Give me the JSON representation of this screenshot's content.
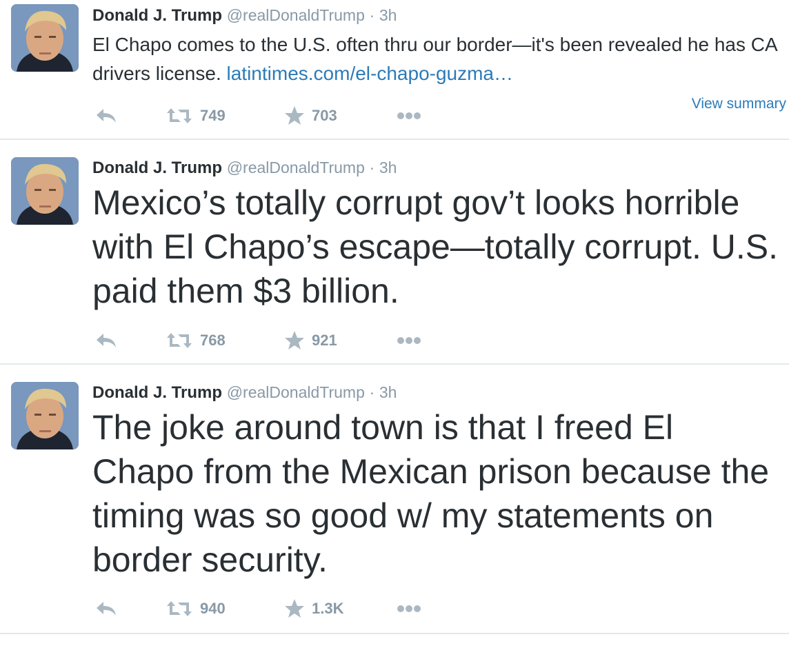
{
  "tweets": [
    {
      "author": {
        "name": "Donald J. Trump",
        "handle": "@realDonaldTrump",
        "separator": "·",
        "time": "3h"
      },
      "text": "El Chapo comes to the U.S. often thru our border—it's been revealed he has CA drivers license. ",
      "link": "latintimes.com/el-chapo-guzma…",
      "view_summary": "View summary",
      "retweets": "749",
      "favorites": "703"
    },
    {
      "author": {
        "name": "Donald J. Trump",
        "handle": "@realDonaldTrump",
        "separator": "·",
        "time": "3h"
      },
      "text": "Mexico’s totally corrupt gov’t looks horrible with El Chapo’s escape—totally corrupt. U.S. paid them $3 billion.",
      "retweets": "768",
      "favorites": "921"
    },
    {
      "author": {
        "name": "Donald J. Trump",
        "handle": "@realDonaldTrump",
        "separator": "·",
        "time": "3h"
      },
      "text": "The joke around town is that I freed El Chapo from the Mexican prison because the timing was so good w/ my statements on border security.",
      "retweets": "940",
      "favorites": "1.3K"
    }
  ],
  "icons": {
    "reply": "reply-icon",
    "retweet": "retweet-icon",
    "favorite": "star-icon",
    "more": "more-dots-icon"
  },
  "colors": {
    "text": "#292f33",
    "muted": "#8899a6",
    "link": "#2b7bb9",
    "icon": "#aab8c2",
    "divider": "#e1e8ed"
  }
}
